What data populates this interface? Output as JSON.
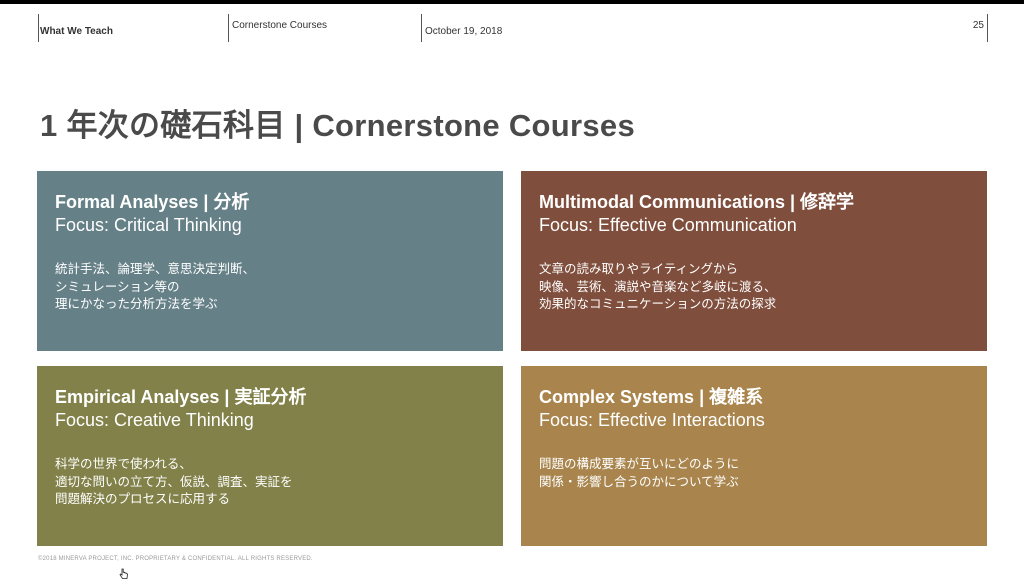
{
  "header": {
    "section": "What We Teach",
    "course": "Cornerstone Courses",
    "date": "October 19, 2018",
    "page_number": "25"
  },
  "slide": {
    "title": "1 年次の礎石科目 | Cornerstone Courses"
  },
  "cards": [
    {
      "title": "Formal Analyses | 分析",
      "focus": "Focus: Critical Thinking",
      "desc": [
        "統計手法、論理学、意思決定判断、",
        "シミュレーション等の",
        "理にかなった分析方法を学ぶ"
      ],
      "color": "#658087"
    },
    {
      "title": "Multimodal Communications | 修辞学",
      "focus": "Focus: Effective Communication",
      "desc": [
        "文章の読み取りやライティングから",
        "映像、芸術、演説や音楽など多岐に渡る、",
        "効果的なコミュニケーションの方法の探求"
      ],
      "color": "#7f4e3c"
    },
    {
      "title": "Empirical Analyses | 実証分析",
      "focus": "Focus: Creative Thinking",
      "desc": [
        "科学の世界で使われる、",
        "適切な問いの立て方、仮説、調査、実証を",
        "問題解決のプロセスに応用する"
      ],
      "color": "#818149"
    },
    {
      "title": "Complex Systems | 複雑系",
      "focus": "Focus: Effective Interactions",
      "desc": [
        "問題の構成要素が互いにどのように",
        "関係・影響し合うのかについて学ぶ"
      ],
      "color": "#a9854d"
    }
  ],
  "footer": {
    "text": "©2018 MINERVA PROJECT, INC. PROPRIETARY & CONFIDENTIAL. ALL RIGHTS RESERVED."
  }
}
